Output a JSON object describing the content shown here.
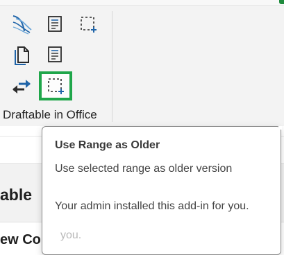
{
  "ribbon": {
    "group_label": "Draftable in Office",
    "buttons": [
      {
        "name": "compare-icon"
      },
      {
        "name": "document-list-icon"
      },
      {
        "name": "selection-range-icon"
      },
      {
        "name": "copy-document-icon"
      },
      {
        "name": "document-list-icon"
      },
      {
        "name": "swap-arrows-icon"
      },
      {
        "name": "use-range-as-older-icon"
      }
    ]
  },
  "background": {
    "partial_title": "able",
    "partial_text": "ew Com"
  },
  "tooltip": {
    "title": "Use Range as Older",
    "description": "Use selected range as older version",
    "admin_note": "Your admin installed this add-in for you.",
    "ghost_text": "you."
  },
  "colors": {
    "accent_blue": "#1f64a8",
    "highlight_green": "#1fa64a",
    "status_green": "#1e8a3c"
  }
}
